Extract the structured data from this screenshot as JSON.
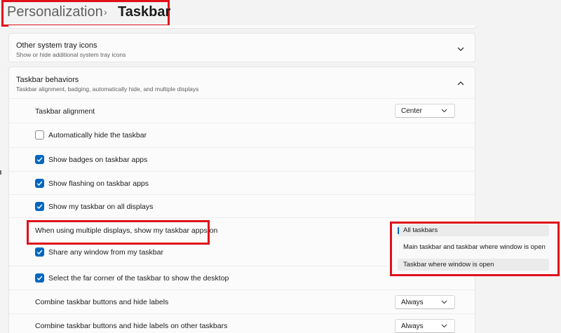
{
  "breadcrumb": {
    "parent": "Personalization",
    "separator": "›",
    "current": "Taskbar"
  },
  "sections": {
    "tray": {
      "title": "Other system tray icons",
      "subtitle": "Show or hide additional system tray icons",
      "expanded": false
    },
    "behaviors": {
      "title": "Taskbar behaviors",
      "subtitle": "Taskbar alignment, badging, automatically hide, and multiple displays",
      "expanded": true
    }
  },
  "settings": {
    "alignment": {
      "label": "Taskbar alignment",
      "value": "Center"
    },
    "auto_hide": {
      "label": "Automatically hide the taskbar",
      "checked": false
    },
    "badges": {
      "label": "Show badges on taskbar apps",
      "checked": true
    },
    "flashing": {
      "label": "Show flashing on taskbar apps",
      "checked": true
    },
    "all_displays": {
      "label": "Show my taskbar on all displays",
      "checked": true
    },
    "multi_display": {
      "label": "When using multiple displays, show my taskbar apps on",
      "options": [
        "All taskbars",
        "Main taskbar and taskbar where window is open",
        "Taskbar where window is open"
      ],
      "selected": "All taskbars"
    },
    "share_window": {
      "label": "Share any window from my taskbar",
      "checked": true
    },
    "far_corner": {
      "label": "Select the far corner of the taskbar to show the desktop",
      "checked": true
    },
    "combine": {
      "label": "Combine taskbar buttons and hide labels",
      "value": "Always"
    },
    "combine_other": {
      "label": "Combine taskbar buttons and hide labels on other taskbars",
      "value": "Always"
    }
  },
  "colors": {
    "accent": "#0067c0",
    "annotation": "#e0101b",
    "background": "#f3f3f3"
  },
  "icons": {
    "chevron_down": "chevron-down-icon",
    "chevron_up": "chevron-up-icon",
    "check": "check-icon"
  }
}
